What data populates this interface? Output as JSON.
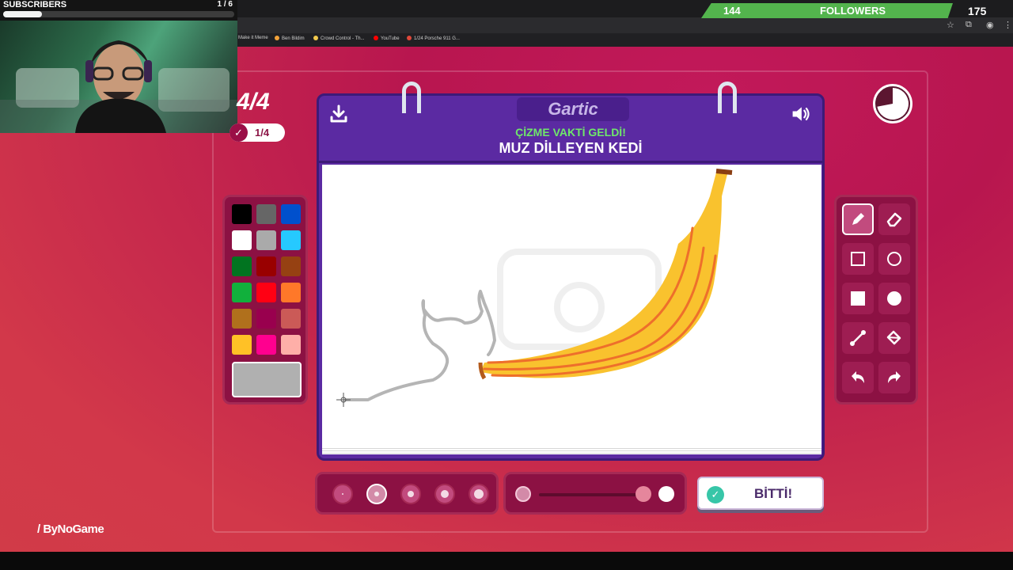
{
  "overlay": {
    "subscribers_label": "SUBSCRIBERS",
    "subscribers_count": "1 / 6",
    "subscribers_progress": 0.167,
    "followers_current": "144",
    "followers_label": "FOLLOWERS",
    "followers_goal": "175",
    "watermark": "ByNoGame"
  },
  "bookmarks": [
    {
      "label": "Make it Meme",
      "color": "#e0e0e0"
    },
    {
      "label": "Ben Bildim",
      "color": "#f2a23a"
    },
    {
      "label": "Crowd Control - Th...",
      "color": "#f2c94c"
    },
    {
      "label": "YouTube",
      "color": "#ff0000"
    },
    {
      "label": "1/24 Porsche 911 G...",
      "color": "#e0483a"
    }
  ],
  "game": {
    "round": "4/4",
    "sub_round": "1/4",
    "logo": "Gartic",
    "subtitle": "ÇİZME VAKTİ GELDİ!",
    "prompt": "MUZ DİLLEYEN KEDİ",
    "done_label": "BİTTİ!",
    "timer_remaining": 0.72,
    "selected_color": "#b0b0b0",
    "selected_tool": "pencil",
    "selected_size_index": 1,
    "opacity_value": 1
  },
  "palette": [
    "#000000",
    "#666666",
    "#0050cd",
    "#ffffff",
    "#aaaaaa",
    "#26c9ff",
    "#017420",
    "#990000",
    "#964112",
    "#11b03c",
    "#ff0013",
    "#ff7829",
    "#b0701c",
    "#99004e",
    "#cb5a57",
    "#ffc126",
    "#ff008f",
    "#feafa8"
  ],
  "tools": [
    "pencil-icon",
    "eraser-icon",
    "rectangle-outline-icon",
    "circle-outline-icon",
    "rectangle-fill-icon",
    "circle-fill-icon",
    "line-icon",
    "fill-bucket-icon",
    "undo-icon",
    "redo-icon"
  ]
}
